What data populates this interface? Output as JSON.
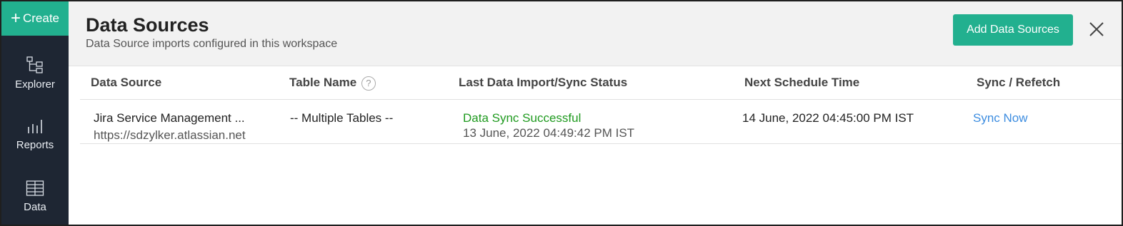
{
  "sidebar": {
    "create_label": "Create",
    "items": [
      {
        "label": "Explorer",
        "icon": "explorer-icon"
      },
      {
        "label": "Reports",
        "icon": "reports-icon"
      },
      {
        "label": "Data",
        "icon": "data-icon"
      }
    ]
  },
  "header": {
    "title": "Data Sources",
    "subtitle": "Data Source imports configured in this workspace",
    "add_button": "Add Data Sources",
    "close_icon": "close-icon"
  },
  "table": {
    "columns": [
      "Data Source",
      "Table Name",
      "Last Data Import/Sync Status",
      "Next Schedule Time",
      "Sync / Refetch"
    ],
    "rows": [
      {
        "source_name": "Jira Service Management ...",
        "source_url": "https://sdzylker.atlassian.net",
        "table_name": "-- Multiple Tables --",
        "status": "Data Sync Successful",
        "status_time": "13 June, 2022 04:49:42 PM IST",
        "next_schedule": "14 June, 2022 04:45:00 PM IST",
        "action": "Sync Now"
      }
    ]
  },
  "colors": {
    "accent": "#22b08f",
    "sidebar_bg": "#1e2633",
    "success": "#1f9a1f",
    "link": "#3d8de0"
  }
}
